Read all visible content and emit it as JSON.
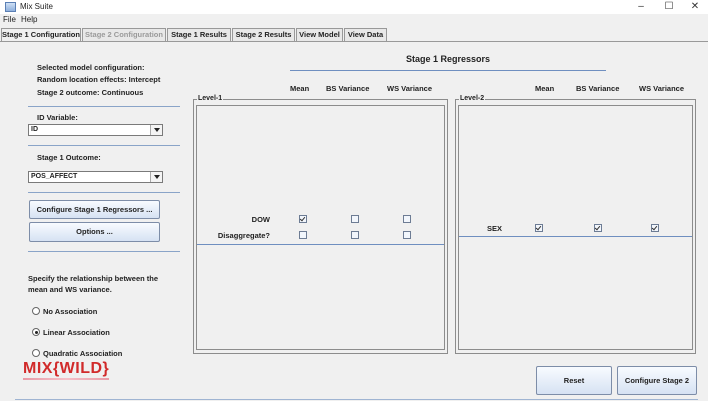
{
  "window": {
    "title": "Mix Suite"
  },
  "menu": [
    "File",
    "Help"
  ],
  "tabs": [
    {
      "label": "Stage 1 Configuration",
      "state": "active"
    },
    {
      "label": "Stage 2 Configuration",
      "state": "disabled"
    },
    {
      "label": "Stage 1 Results",
      "state": "normal"
    },
    {
      "label": "Stage 2 Results",
      "state": "normal"
    },
    {
      "label": "View Model",
      "state": "normal"
    },
    {
      "label": "View Data",
      "state": "normal"
    }
  ],
  "model_info": {
    "line1": "Selected model configuration:",
    "line2": "Random location effects: Intercept",
    "line3": "Stage 2 outcome: Continuous"
  },
  "id_variable": {
    "label": "ID Variable:",
    "value": "ID"
  },
  "stage1_outcome": {
    "label": "Stage 1 Outcome:",
    "value": "POS_AFFECT"
  },
  "buttons": {
    "configure_regressors": "Configure Stage 1 Regressors ...",
    "options": "Options ...",
    "reset": "Reset",
    "configure_stage2": "Configure Stage 2"
  },
  "association": {
    "prompt_line1": "Specify the relationship between the",
    "prompt_line2": "mean and WS variance.",
    "options": [
      "No Association",
      "Linear Association",
      "Quadratic Association"
    ],
    "selected": "Linear Association"
  },
  "regressors": {
    "title": "Stage 1 Regressors",
    "columns": [
      "Mean",
      "BS Variance",
      "WS Variance"
    ],
    "level1": {
      "legend": "Level-1",
      "rows": [
        {
          "name": "DOW",
          "mean": true,
          "bs": false,
          "ws": false
        },
        {
          "name": "Disaggregate?",
          "mean": false,
          "bs": false,
          "ws": false
        }
      ]
    },
    "level2": {
      "legend": "Level-2",
      "rows": [
        {
          "name": "SEX",
          "mean": true,
          "bs": true,
          "ws": true
        }
      ]
    }
  },
  "logo": {
    "text": "MIX{WILD}",
    "accent_color": "#d12a2a"
  }
}
